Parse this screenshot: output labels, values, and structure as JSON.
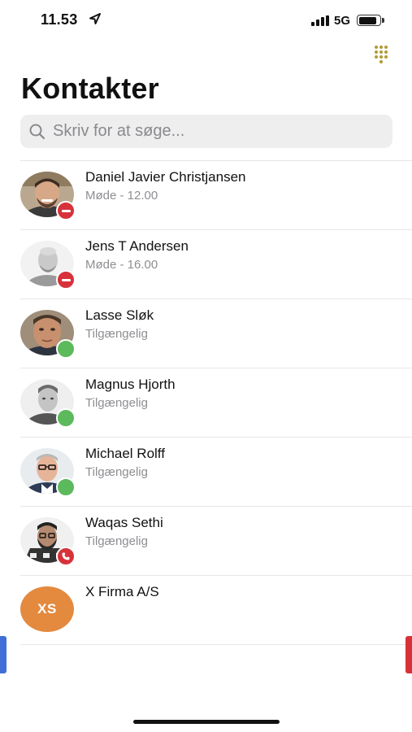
{
  "status_bar": {
    "time": "11.53",
    "network": "5G",
    "battery_level": 0.85
  },
  "header": {
    "title": "Kontakter",
    "dialpad_icon": "dialpad-grid-icon"
  },
  "search": {
    "placeholder": "Skriv for at søge...",
    "value": "",
    "icon": "search-icon"
  },
  "contacts": [
    {
      "name": "Daniel Javier Christjansen",
      "status": "Møde - 12.00",
      "presence": "busy"
    },
    {
      "name": "Jens T Andersen",
      "status": "Møde - 16.00",
      "presence": "busy"
    },
    {
      "name": "Lasse Sløk",
      "status": "Tilgængelig",
      "presence": "available"
    },
    {
      "name": "Magnus Hjorth",
      "status": "Tilgængelig",
      "presence": "available"
    },
    {
      "name": "Michael Rolff",
      "status": "Tilgængelig",
      "presence": "available"
    },
    {
      "name": "Waqas Sethi",
      "status": "Tilgængelig",
      "presence": "on-call"
    },
    {
      "name": "X Firma A/S",
      "status": "",
      "presence": "none",
      "initials": "XS"
    }
  ],
  "colors": {
    "busy": "#d7323a",
    "available": "#5cb95c",
    "company_avatar": "#e38a3f",
    "dialpad": "#b39a35",
    "left_edge_tab": "#3f6fd8",
    "right_edge_tab": "#d7323a"
  }
}
